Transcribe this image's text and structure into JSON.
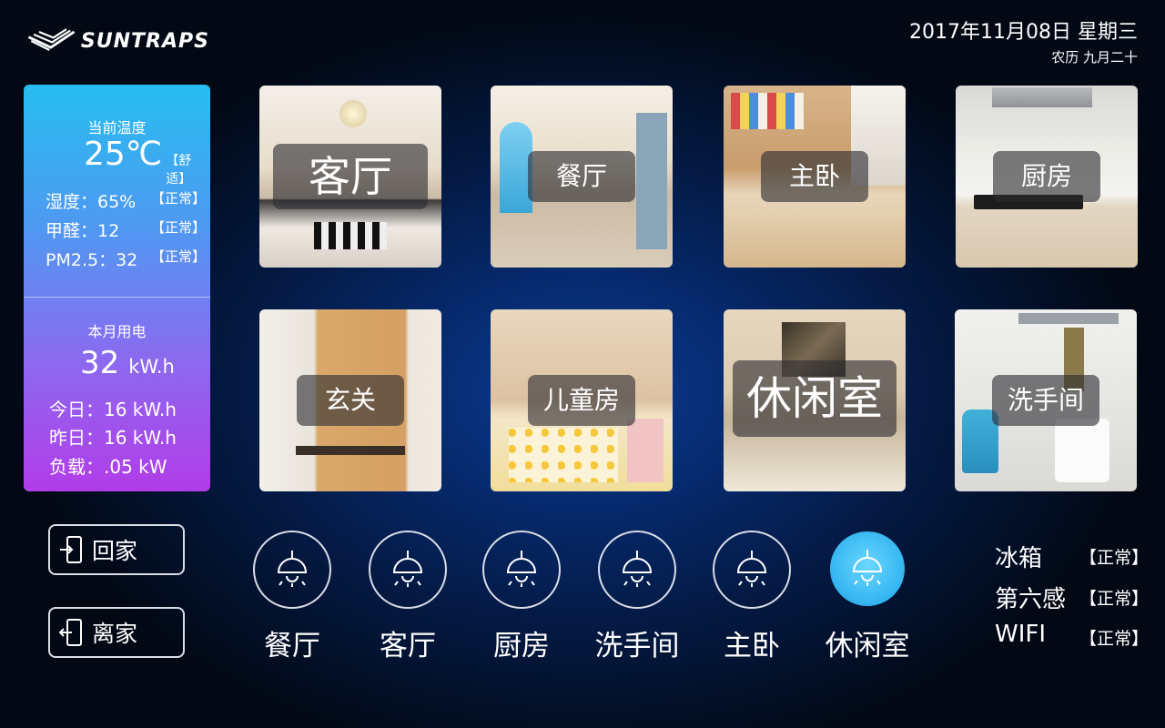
{
  "brand": {
    "logo_text": "SUNTRAPS"
  },
  "date": {
    "main": "2017年11月08日  星期三",
    "lunar": "农历 九月二十"
  },
  "environment": {
    "temp_title": "当前温度",
    "temp_value": "25℃",
    "temp_state": "【舒适】",
    "humidity_label": "湿度：65%",
    "humidity_state": "【正常】",
    "formaldehyde_label": "甲醛：12",
    "formaldehyde_state": "【正常】",
    "pm25_label": "PM2.5：32",
    "pm25_state": "【正常】",
    "electricity_title": "本月用电",
    "electricity_value": "32",
    "electricity_unit": "kW.h",
    "today": "今日：16 kW.h",
    "yesterday": "昨日：16 kW.h",
    "load": "负载：.05 kW"
  },
  "rooms": [
    {
      "label": "客厅"
    },
    {
      "label": "餐厅"
    },
    {
      "label": "主卧"
    },
    {
      "label": "厨房"
    },
    {
      "label": "玄关"
    },
    {
      "label": "儿童房"
    },
    {
      "label": "休闲室"
    },
    {
      "label": "洗手间"
    }
  ],
  "modes": {
    "home": "回家",
    "away": "离家"
  },
  "lights": [
    {
      "label": "餐厅",
      "on": false
    },
    {
      "label": "客厅",
      "on": false
    },
    {
      "label": "厨房",
      "on": false
    },
    {
      "label": "洗手间",
      "on": false
    },
    {
      "label": "主卧",
      "on": false
    },
    {
      "label": "休闲室",
      "on": true
    }
  ],
  "devices": [
    {
      "name": "冰箱",
      "state": "【正常】"
    },
    {
      "name": "第六感",
      "state": "【正常】"
    },
    {
      "name": "WIFI",
      "state": "【正常】"
    }
  ],
  "colors": {
    "light_on": "#33b4f0",
    "card_top": "#27bdf0",
    "card_bottom": "#b23ce8"
  }
}
